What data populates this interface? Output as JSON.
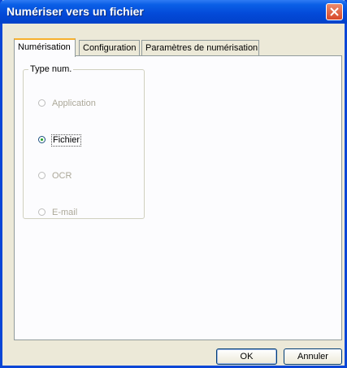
{
  "window": {
    "title": "Numériser vers un fichier"
  },
  "tabs": [
    {
      "label": "Numérisation",
      "active": true
    },
    {
      "label": "Configuration",
      "active": false
    },
    {
      "label": "Paramètres de numérisation",
      "active": false
    }
  ],
  "scan_type": {
    "group_title": "Type num.",
    "options": [
      {
        "label": "Application",
        "enabled": false,
        "selected": false
      },
      {
        "label": "Fichier",
        "enabled": true,
        "selected": true
      },
      {
        "label": "OCR",
        "enabled": false,
        "selected": false
      },
      {
        "label": "E-mail",
        "enabled": false,
        "selected": false
      }
    ]
  },
  "buttons": {
    "ok": "OK",
    "cancel": "Annuler"
  },
  "colors": {
    "titlebar": "#0349d8",
    "close": "#d8482a",
    "accent_tab": "#f7b02e"
  },
  "icons": {
    "close": "close-icon"
  }
}
